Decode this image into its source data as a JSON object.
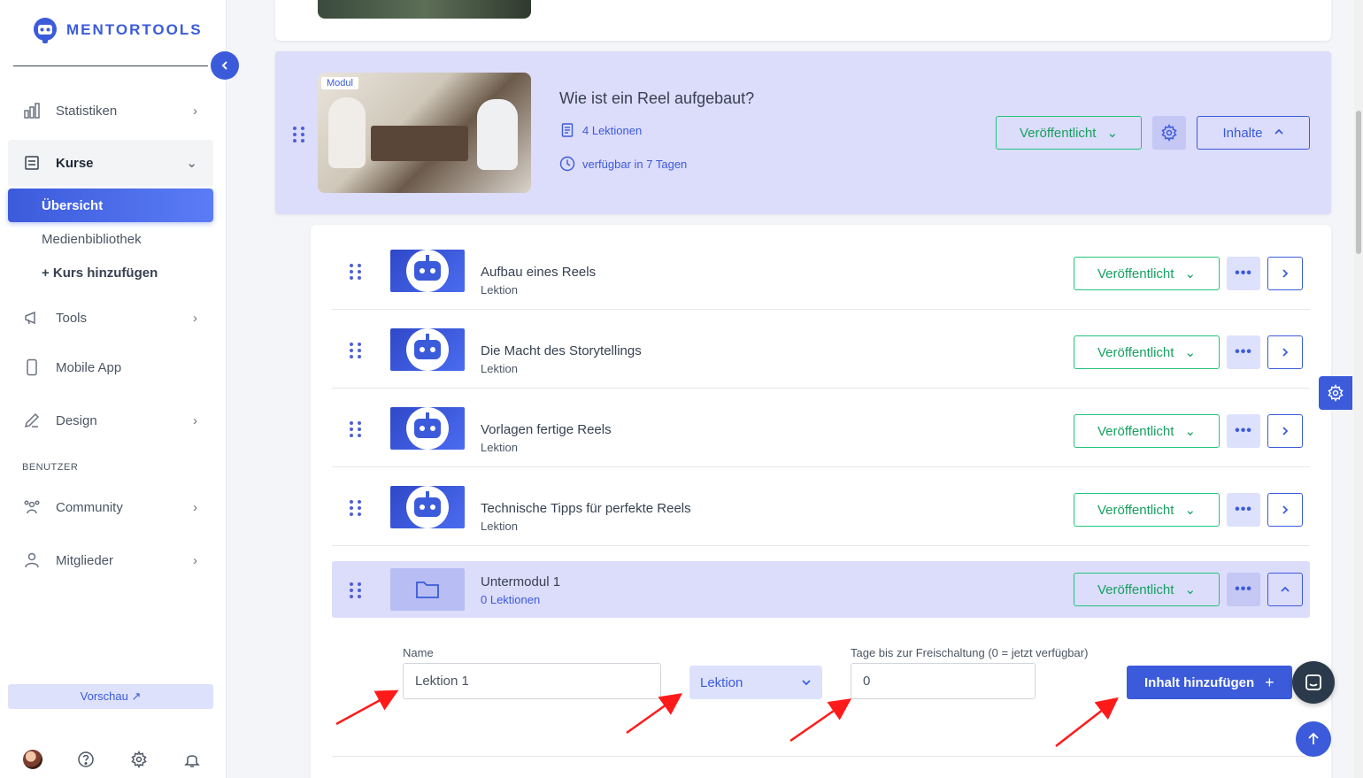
{
  "brand": {
    "name": "MENTORTOOLS",
    "accent": "#3b5bdb",
    "publish_color": "#22c57a"
  },
  "sidebar": {
    "items": [
      {
        "label": "Statistiken",
        "icon": "bar-chart-icon"
      },
      {
        "label": "Kurse",
        "icon": "book-icon"
      },
      {
        "label": "Tools",
        "icon": "megaphone-icon"
      },
      {
        "label": "Mobile App",
        "icon": "mobile-icon"
      },
      {
        "label": "Design",
        "icon": "pencil-icon"
      },
      {
        "label": "Community",
        "icon": "users-icon"
      },
      {
        "label": "Mitglieder",
        "icon": "user-icon"
      }
    ],
    "sub_items": [
      "Übersicht",
      "Medienbibliothek",
      "+ Kurs hinzufügen"
    ],
    "section_label": "BENUTZER",
    "preview_label": "Vorschau ↗"
  },
  "module": {
    "badge": "Modul",
    "title": "Wie ist ein Reel aufgebaut?",
    "lessons": "4 Lektionen",
    "availability": "verfügbar in 7 Tagen",
    "status": "Veröffentlicht",
    "content_label": "Inhalte"
  },
  "lessons": [
    {
      "title": "Aufbau eines Reels",
      "type": "Lektion",
      "status": "Veröffentlicht"
    },
    {
      "title": "Die Macht des Storytellings",
      "type": "Lektion",
      "status": "Veröffentlicht"
    },
    {
      "title": "Vorlagen fertige Reels",
      "type": "Lektion",
      "status": "Veröffentlicht"
    },
    {
      "title": "Technische Tipps für perfekte Reels",
      "type": "Lektion",
      "status": "Veröffentlicht"
    }
  ],
  "submodule": {
    "title": "Untermodul 1",
    "lessons": "0 Lektionen",
    "status": "Veröffentlicht"
  },
  "form": {
    "name_label": "Name",
    "name_value": "Lektion 1",
    "type_value": "Lektion",
    "days_label": "Tage bis zur Freischaltung (0 = jetzt verfügbar)",
    "days_value": "0",
    "add_label": "Inhalt hinzufügen"
  }
}
